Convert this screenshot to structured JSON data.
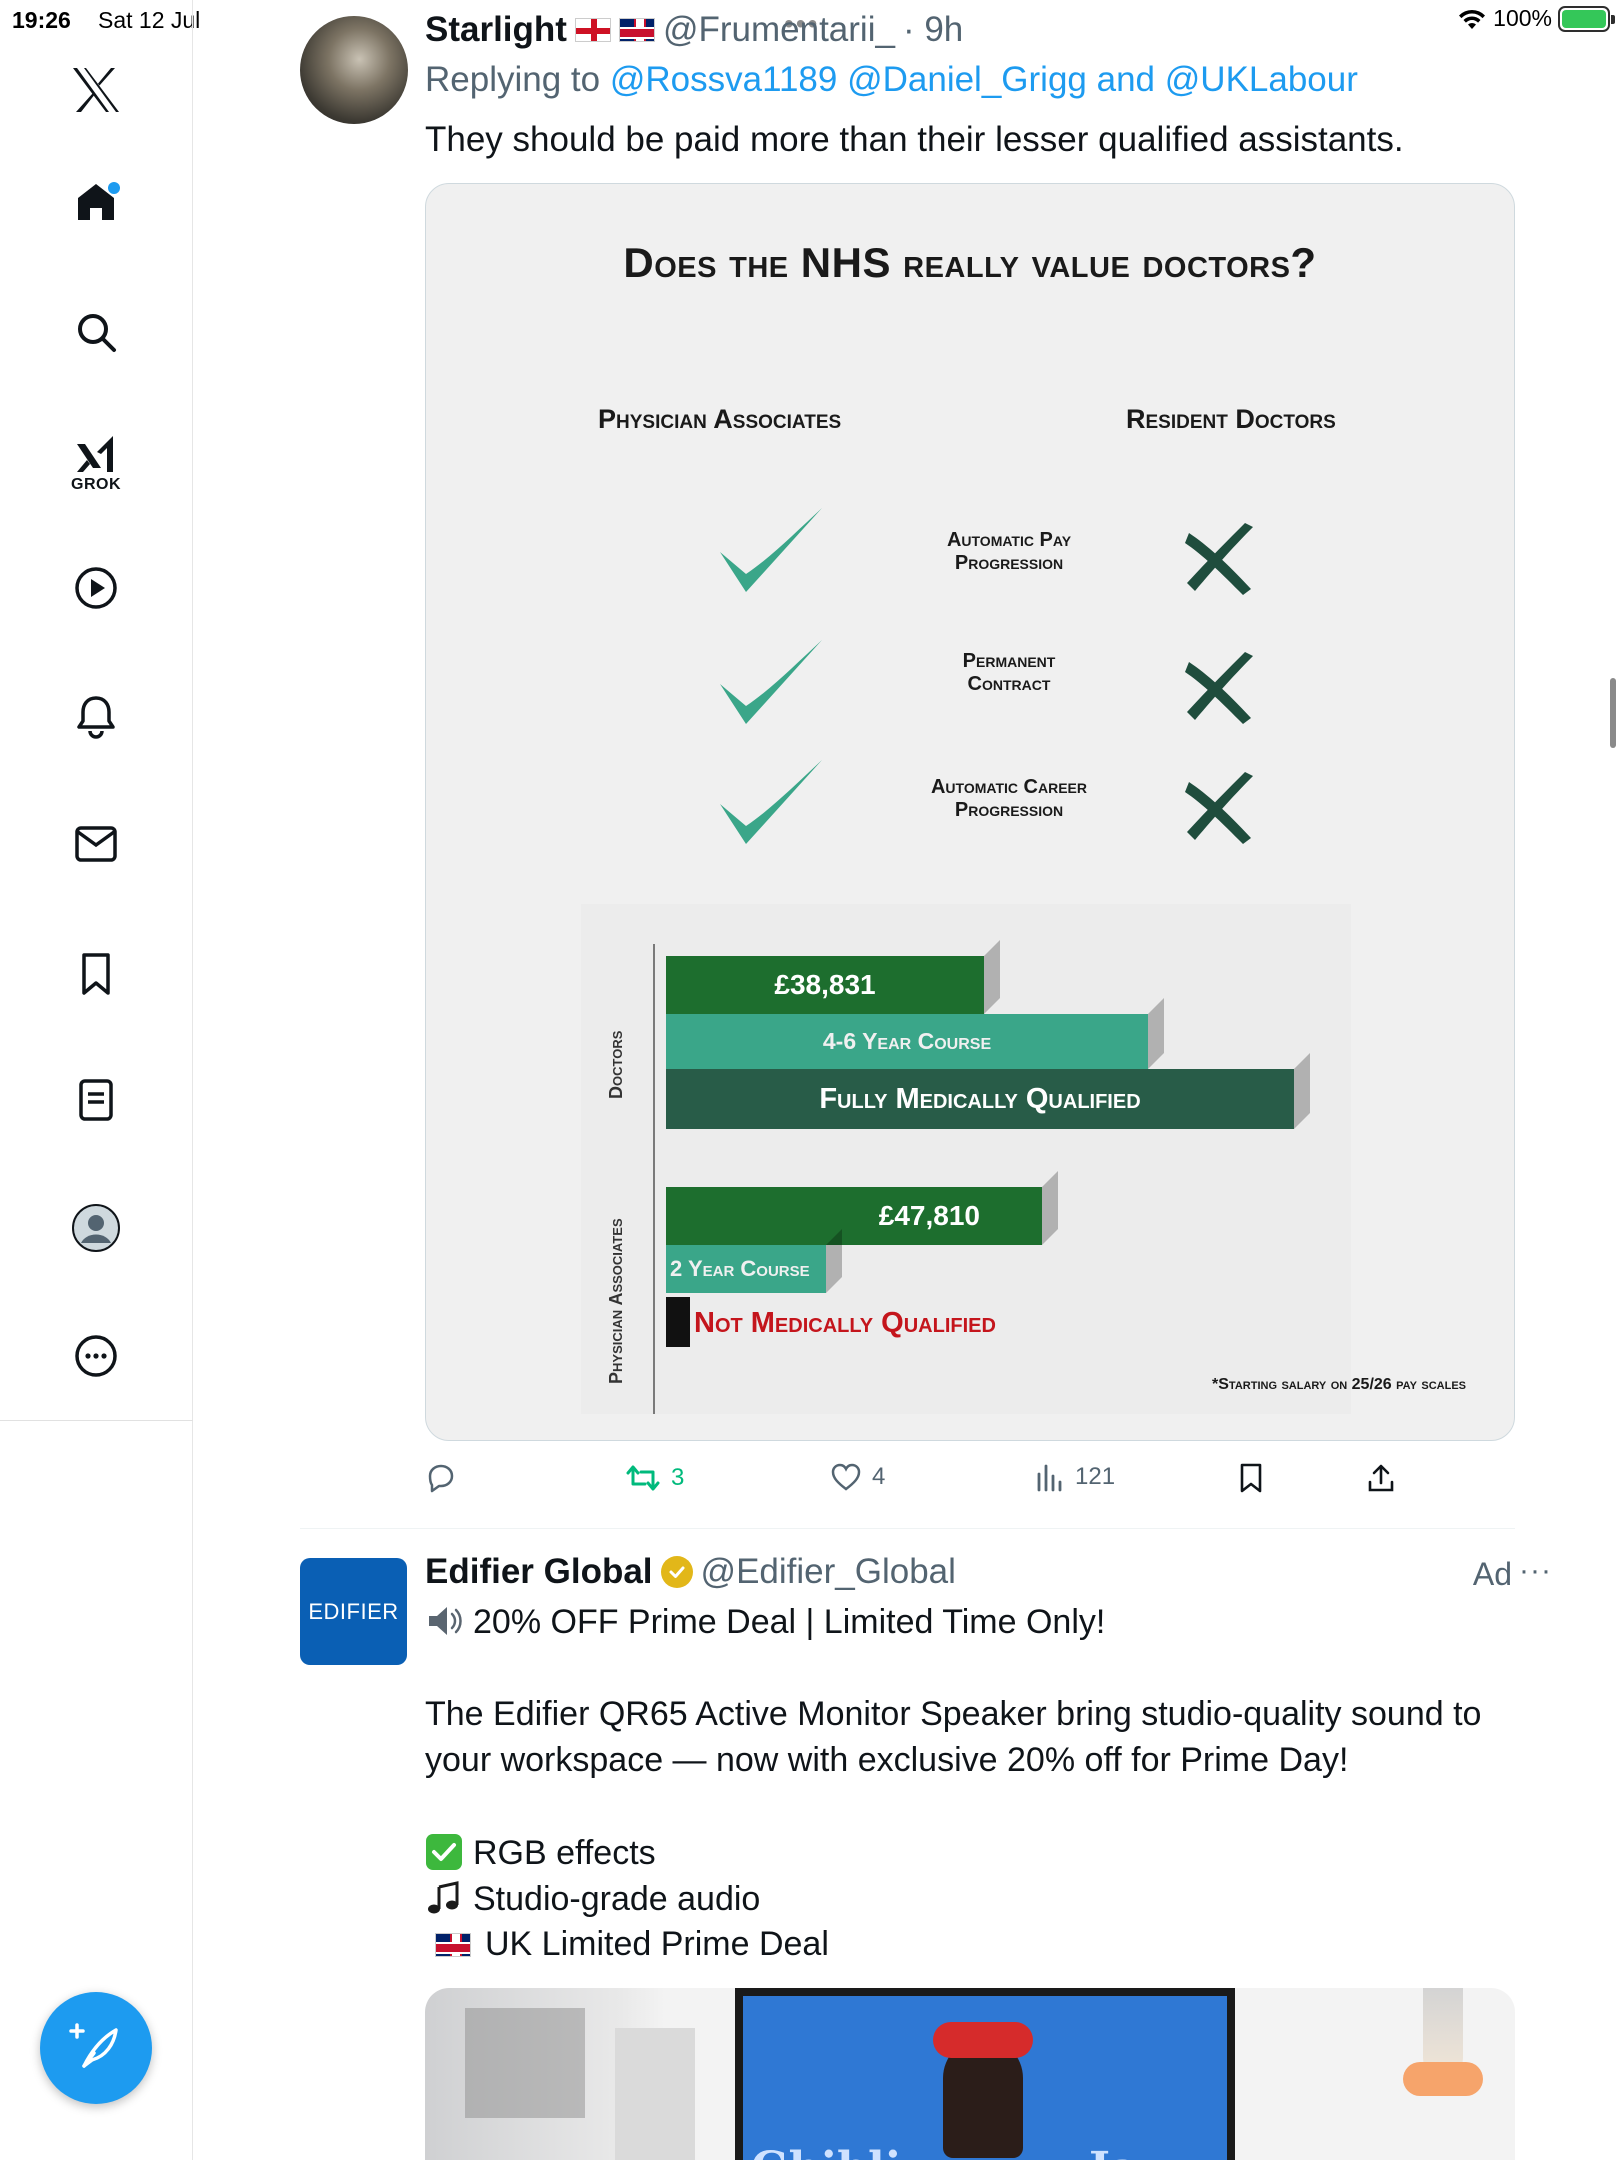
{
  "status_bar": {
    "time": "19:26",
    "date": "Sat 12 Jul",
    "battery": "100%"
  },
  "sidebar": {
    "grok_label": "GROK",
    "accent_color": "#1d9bf0"
  },
  "tweet": {
    "name": "Starlight",
    "handle": "@Frumentarii_",
    "time": "· 9h",
    "reply_prefix": "Replying to",
    "reply_to_1": "@Rossva1189",
    "reply_to_2": "@Daniel_Grigg",
    "reply_and": "and",
    "reply_to_3": "@UKLabour",
    "text": "They should be paid more than their lesser qualified assistants.",
    "image": {
      "title": "Does the NHS really value doctors?",
      "col_left": "Physician Associates",
      "col_right": "Resident Doctors",
      "rows": [
        {
          "line1": "Automatic Pay",
          "line2": "Progression"
        },
        {
          "line1": "Permanent",
          "line2": "Contract"
        },
        {
          "line1": "Automatic Career",
          "line2": "Progression"
        }
      ],
      "group_doctors": "Doctors",
      "group_pa": "Physician Associates",
      "doctors_salary": "£38,831",
      "doctors_course": "4-6 Year Course",
      "doctors_qual": "Fully Medically Qualified",
      "pa_salary": "£47,810",
      "pa_course": "2 Year Course",
      "pa_qual": "Not Medically Qualified",
      "footnote": "*Starting salary on 25/26 pay scales"
    },
    "actions": {
      "retweets": "3",
      "likes": "4",
      "views": "121"
    }
  },
  "ad": {
    "avatar_text": "EDIFIER",
    "name": "Edifier Global",
    "handle": "@Edifier_Global",
    "label": "Ad",
    "more": "···",
    "headline": "20% OFF Prime Deal | Limited Time Only!",
    "body_1": "The Edifier QR65 Active Monitor Speaker bring studio-quality sound to",
    "body_2": "your workspace — now with exclusive 20% off for Prime Day!",
    "bullet_1": "RGB effects",
    "bullet_2": "Studio-grade audio",
    "bullet_3": "UK Limited Prime Deal",
    "image_text_left": "Ghibli",
    "image_text_right": "Jazz"
  }
}
